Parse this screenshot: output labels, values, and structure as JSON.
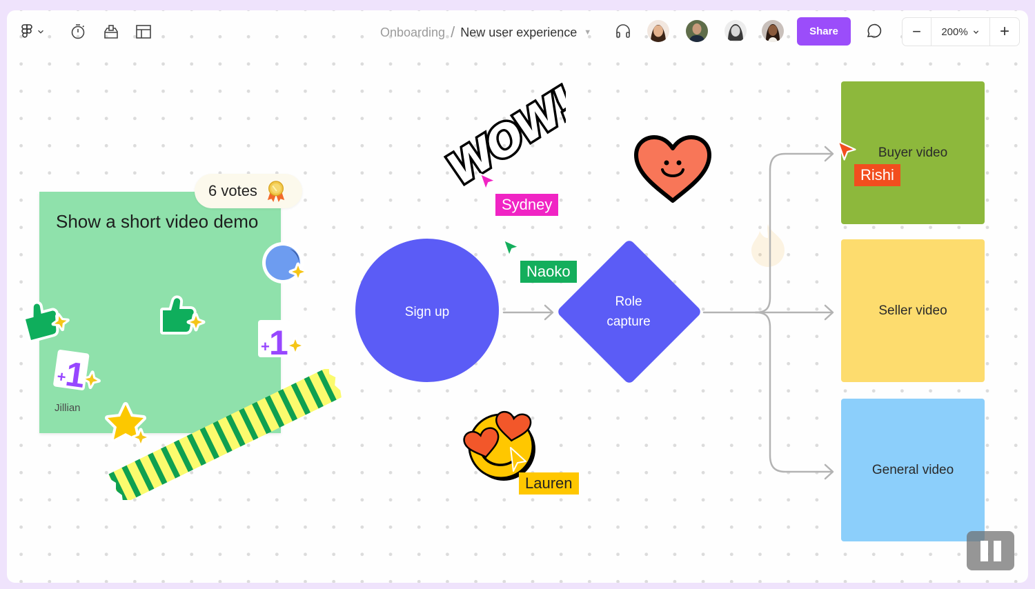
{
  "toolbar": {
    "left_icons": [
      {
        "name": "figma-logo-icon",
        "label": "Main menu"
      },
      {
        "name": "timer-icon",
        "label": "Timer"
      },
      {
        "name": "voting-icon",
        "label": "Voting"
      },
      {
        "name": "layout-icon",
        "label": "Layout"
      }
    ],
    "breadcrumb": {
      "parent": "Onboarding",
      "separator": "/",
      "current": "New user experience"
    },
    "audio_icon": "headphones-icon",
    "collaborators": [
      {
        "name": "Collaborator 1",
        "skin": "#e3b28d",
        "hair": "#3b2416",
        "bg": "#f2e7df"
      },
      {
        "name": "Collaborator 2",
        "skin": "#c79b7c",
        "hair": "#2f3b2a",
        "bg": "#5f6d4a"
      },
      {
        "name": "Collaborator 3",
        "skin": "#d5d5d5",
        "hair": "#3a3a3a",
        "bg": "#ececec"
      },
      {
        "name": "Collaborator 4",
        "skin": "#8a5a3c",
        "hair": "#2b1a12",
        "bg": "#c9c0bb"
      }
    ],
    "share_label": "Share",
    "comment_icon": "comment-icon",
    "zoom": {
      "minus": "−",
      "level": "200%",
      "plus": "+"
    }
  },
  "canvas": {
    "sticky": {
      "text": "Show a short video demo",
      "author": "Jillian",
      "color": "#8fe1ab",
      "votes_label": "6 votes"
    },
    "stickers": [
      "thumbs-up",
      "thumbs-up",
      "plus-one",
      "plus-one",
      "star",
      "moon",
      "wow",
      "smiley-heart",
      "heart-eyes-emoji",
      "washi-tape",
      "fire"
    ],
    "cursors": [
      {
        "name": "Sydney",
        "color": "#f024c4"
      },
      {
        "name": "Naoko",
        "color": "#14ae5c"
      },
      {
        "name": "Rishi",
        "color": "#f24e1e"
      },
      {
        "name": "Lauren",
        "color": "#ffc700"
      }
    ],
    "flow": {
      "start": {
        "label": "Sign up",
        "color": "#5b5cf6"
      },
      "decision": {
        "label_line1": "Role",
        "label_line2": "capture",
        "color": "#5b5cf6"
      },
      "outcomes": [
        {
          "label": "Buyer video",
          "color": "#8db83c"
        },
        {
          "label": "Seller video",
          "color": "#fddc6e"
        },
        {
          "label": "General video",
          "color": "#8ccffb"
        }
      ],
      "connector_color": "#b3b3b3"
    }
  },
  "playback": {
    "pause_icon": "pause-icon"
  }
}
